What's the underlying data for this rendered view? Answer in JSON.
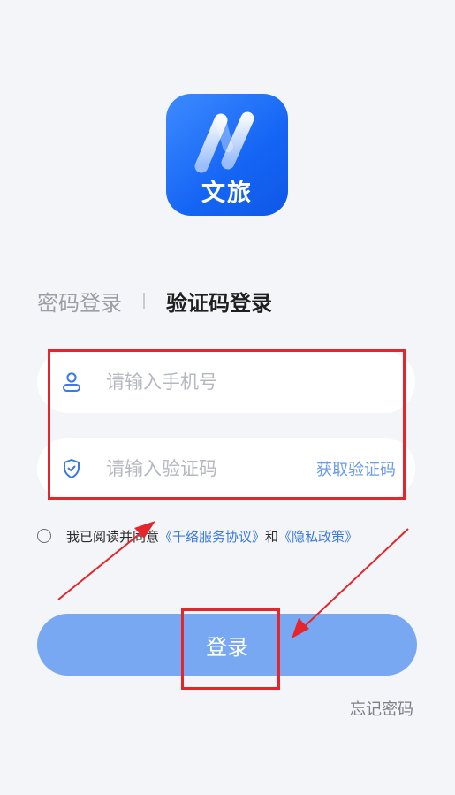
{
  "app": {
    "logo_text": "文旅",
    "brand_color": "#1a6ef5"
  },
  "tabs": {
    "password_login": "密码登录",
    "code_login": "验证码登录",
    "active": "code_login"
  },
  "form": {
    "phone": {
      "value": "",
      "placeholder": "请输入手机号",
      "icon": "user-icon"
    },
    "code": {
      "value": "",
      "placeholder": "请输入验证码",
      "icon": "shield-check-icon"
    },
    "get_code_label": "获取验证码"
  },
  "agreement": {
    "checked": false,
    "prefix": "我已阅读并同意",
    "service_link": "《千络服务协议》",
    "and": "和",
    "privacy_link": "《隐私政策》"
  },
  "login_button": {
    "label": "登录",
    "color": "#79a8f2"
  },
  "forgot_password": "忘记密码",
  "annotation_color": "#e4252b"
}
